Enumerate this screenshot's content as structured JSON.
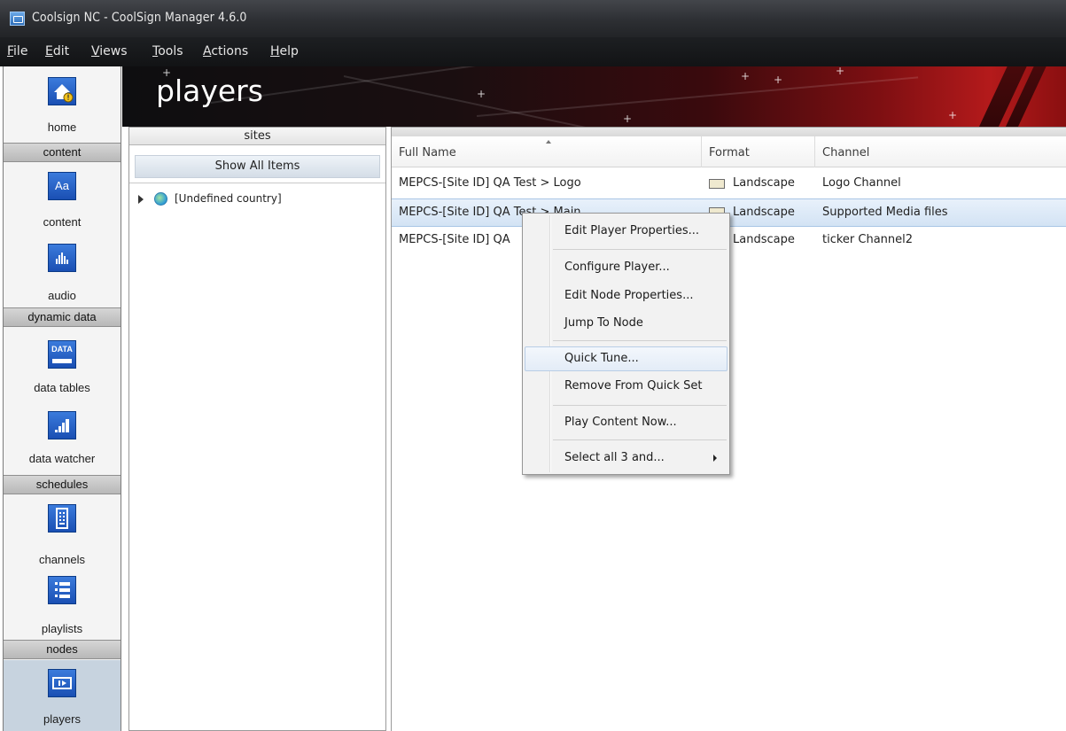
{
  "window": {
    "title": "Coolsign NC - CoolSign Manager 4.6.0"
  },
  "menu": [
    "File",
    "Edit",
    "Views",
    "Tools",
    "Actions",
    "Help"
  ],
  "menu_underline": [
    "F",
    "E",
    "V",
    "T",
    "A",
    "H"
  ],
  "nav": {
    "home": "home",
    "section_content": "content",
    "content": "content",
    "audio": "audio",
    "section_dynamic": "dynamic data",
    "data_tables": "data tables",
    "data_watcher": "data watcher",
    "section_schedules": "schedules",
    "channels": "channels",
    "playlists": "playlists",
    "section_nodes": "nodes",
    "players": "players"
  },
  "icons": {
    "content_glyph": "Aa",
    "data_glyph": "DATA"
  },
  "page": {
    "title": "players"
  },
  "sites": {
    "header": "sites",
    "show_all": "Show All Items",
    "tree": [
      "[Undefined country]"
    ]
  },
  "grid": {
    "columns": [
      "Full Name",
      "Format",
      "Channel"
    ],
    "rows": [
      {
        "name": "MEPCS-[Site ID] QA Test > Logo",
        "format": "Landscape",
        "channel": "Logo Channel"
      },
      {
        "name": "MEPCS-[Site ID] QA Test > Main",
        "format": "Landscape",
        "channel": "Supported Media files"
      },
      {
        "name": "MEPCS-[Site ID] QA",
        "format": "Landscape",
        "channel": "ticker Channel2"
      }
    ]
  },
  "context_menu": [
    "Edit Player Properties...",
    "Configure Player...",
    "Edit Node Properties...",
    "Jump To Node",
    "Quick Tune...",
    "Remove From Quick Set",
    "Play Content Now...",
    "Select all 3 and..."
  ],
  "colors": {
    "accent_red": "#b41a1b",
    "nav_icon_blue": "#1a4fb3",
    "selection": "#d3e3f4"
  }
}
